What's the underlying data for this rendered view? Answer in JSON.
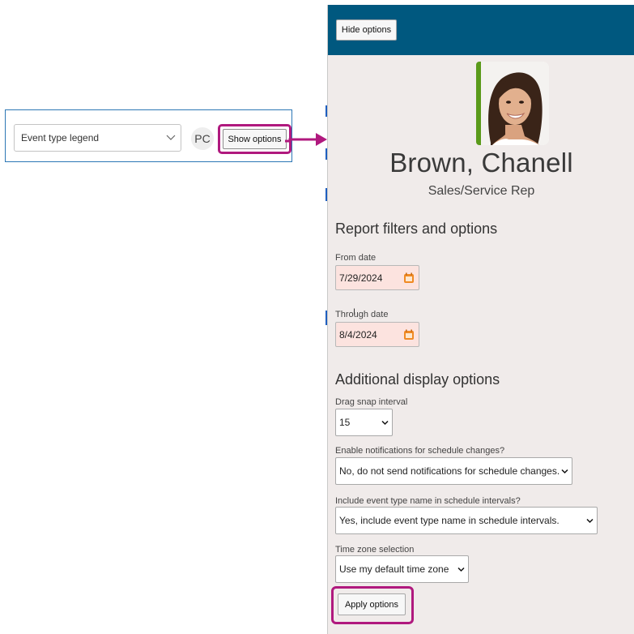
{
  "toolbar": {
    "legend_select_value": "Event type legend",
    "avatar_initials": "PC",
    "show_options_label": "Show options"
  },
  "panel": {
    "hide_options_label": "Hide options",
    "person": {
      "name": "Brown, Chanell",
      "role": "Sales/Service Rep"
    },
    "report_filters": {
      "title": "Report filters and options",
      "from_date_label": "From date",
      "from_date_value": "7/29/2024",
      "through_date_label": "Through date",
      "through_date_value": "8/4/2024"
    },
    "display_options": {
      "title": "Additional display options",
      "drag_snap_label": "Drag snap interval",
      "drag_snap_value": "15",
      "notifications_label": "Enable notifications for schedule changes?",
      "notifications_value": "No, do not send notifications for schedule changes.",
      "event_type_name_label": "Include event type name in schedule intervals?",
      "event_type_name_value": "Yes, include event type name in schedule intervals.",
      "time_zone_label": "Time zone selection",
      "time_zone_value": "Use my default time zone"
    },
    "apply_options_label": "Apply options"
  },
  "colors": {
    "header_bg": "#00587f",
    "panel_bg": "#f0ebea",
    "highlight": "#b0197e",
    "date_input_bg": "#fce3df",
    "photo_accent": "#5a9a1a",
    "calendar_icon": "#f08a24"
  }
}
